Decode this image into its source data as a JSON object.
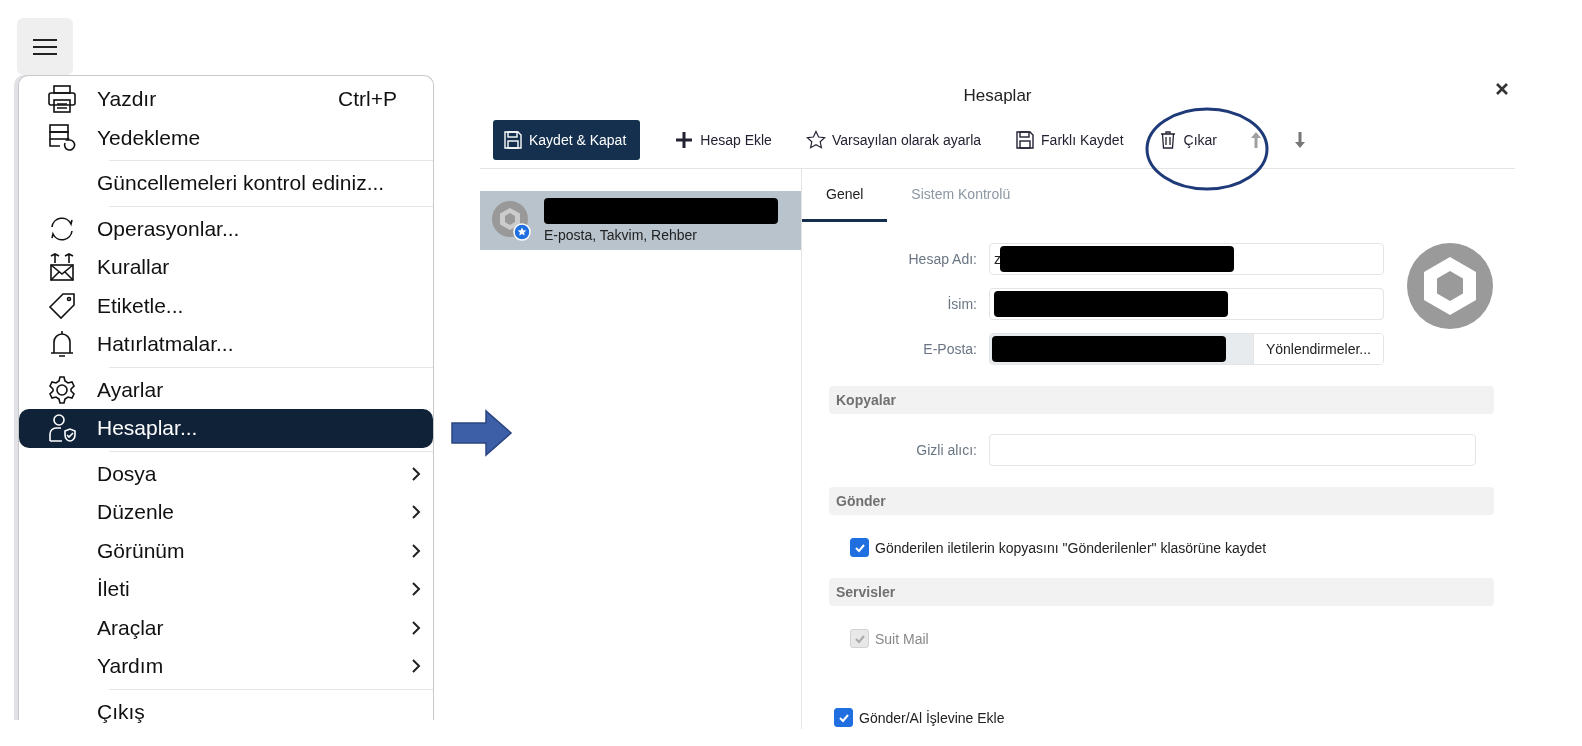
{
  "menu": {
    "items": [
      {
        "kind": "item",
        "label": "Yazdır",
        "shortcut": "Ctrl+P",
        "has_submenu": false,
        "selected": false
      },
      {
        "kind": "item",
        "label": "Yedekleme",
        "has_submenu": false,
        "selected": false
      },
      {
        "kind": "separator"
      },
      {
        "kind": "item",
        "label": "Güncellemeleri kontrol ediniz...",
        "has_submenu": false,
        "selected": false
      },
      {
        "kind": "separator"
      },
      {
        "kind": "item",
        "label": "Operasyonlar...",
        "has_submenu": false,
        "selected": false
      },
      {
        "kind": "item",
        "label": "Kurallar",
        "has_submenu": false,
        "selected": false
      },
      {
        "kind": "item",
        "label": "Etiketle...",
        "has_submenu": false,
        "selected": false
      },
      {
        "kind": "item",
        "label": "Hatırlatmalar...",
        "has_submenu": false,
        "selected": false
      },
      {
        "kind": "separator"
      },
      {
        "kind": "item",
        "label": "Ayarlar",
        "has_submenu": false,
        "selected": false
      },
      {
        "kind": "item",
        "label": "Hesaplar...",
        "has_submenu": false,
        "selected": true
      },
      {
        "kind": "separator"
      },
      {
        "kind": "item",
        "label": "Dosya",
        "has_submenu": true,
        "selected": false
      },
      {
        "kind": "item",
        "label": "Düzenle",
        "has_submenu": true,
        "selected": false
      },
      {
        "kind": "item",
        "label": "Görünüm",
        "has_submenu": true,
        "selected": false
      },
      {
        "kind": "item",
        "label": "İleti",
        "has_submenu": true,
        "selected": false
      },
      {
        "kind": "item",
        "label": "Araçlar",
        "has_submenu": true,
        "selected": false
      },
      {
        "kind": "item",
        "label": "Yardım",
        "has_submenu": true,
        "selected": false
      },
      {
        "kind": "separator"
      },
      {
        "kind": "item",
        "label": "Çıkış",
        "has_submenu": false,
        "selected": false
      }
    ]
  },
  "dialog": {
    "title": "Hesaplar",
    "toolbar": [
      {
        "kind": "save",
        "label": "Kaydet & Kapat",
        "primary": true,
        "disabled": false
      },
      {
        "kind": "add",
        "label": "Hesap Ekle",
        "primary": false,
        "disabled": false
      },
      {
        "kind": "star",
        "label": "Varsayılan olarak ayarla",
        "primary": false,
        "disabled": false
      },
      {
        "kind": "save",
        "label": "Farklı Kaydet",
        "primary": false,
        "disabled": false
      },
      {
        "kind": "trash",
        "label": "Çıkar",
        "primary": false,
        "disabled": false
      },
      {
        "kind": "up",
        "primary": false,
        "disabled": true
      },
      {
        "kind": "down",
        "primary": false,
        "disabled": false
      }
    ],
    "accounts": [
      {
        "name_redacted": true,
        "services": "E-posta, Takvim, Rehber",
        "default": true,
        "selected": true
      }
    ],
    "tabs": [
      {
        "label": "Genel",
        "selected": true
      },
      {
        "label": "Sistem Kontrolü",
        "selected": false
      }
    ],
    "fields": [
      {
        "label": "Hesap Adı:",
        "value": "z",
        "redacted": true
      },
      {
        "label": "İsim:",
        "redacted": true
      },
      {
        "label": "E-Posta:",
        "redacted": true,
        "button": "Yönlendirmeler..."
      }
    ],
    "sections": [
      {
        "title": "Kopyalar",
        "rows": [
          {
            "kind": "field",
            "label": "Gizli alıcı:"
          }
        ]
      },
      {
        "title": "Gönder",
        "rows": [
          {
            "kind": "checkbox",
            "label": "Gönderilen iletilerin kopyasını \"Gönderilenler\" klasörüne kaydet",
            "checked": true,
            "disabled": false
          }
        ]
      },
      {
        "title": "Servisler",
        "rows": [
          {
            "kind": "checkbox",
            "label": "Suit Mail",
            "checked": true,
            "disabled": true
          }
        ]
      }
    ],
    "footer_checkbox": {
      "label": "Gönder/Al İşlevine Ekle",
      "checked": true,
      "disabled": false
    }
  }
}
